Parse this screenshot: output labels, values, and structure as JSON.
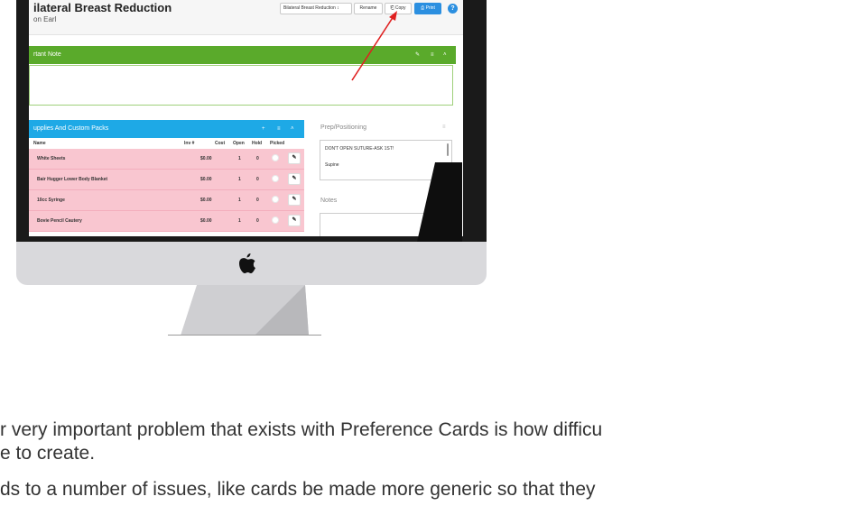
{
  "procedure": {
    "title": "ilateral Breast Reduction",
    "surgeon": "on Earl"
  },
  "toolbar": {
    "card_select": "Bilateral Breast Reduction ↕",
    "rename_label": "Rename",
    "copy_label": "Copy",
    "print_label": "Print",
    "help_label": "?"
  },
  "important_note": {
    "title": "rtant Note",
    "icons": [
      "pencil-icon",
      "menu-icon",
      "chevron-up-icon"
    ],
    "icon_glyphs": [
      "✎",
      "≡",
      "˄"
    ]
  },
  "supplies": {
    "title": "upplies And Custom Packs",
    "icons": [
      "plus-icon",
      "menu-icon",
      "chevron-up-icon"
    ],
    "icon_glyphs": [
      "+",
      "≡",
      "˄"
    ],
    "columns": [
      "Name",
      "Inv #",
      "Cost",
      "Open",
      "Hold",
      "Picked"
    ],
    "rows": [
      {
        "name": "White Sheets",
        "cost": "$0.00",
        "open": "1",
        "hold": "0"
      },
      {
        "name": "Bair Hugger Lower Body Blanket",
        "cost": "$0.00",
        "open": "1",
        "hold": "0"
      },
      {
        "name": "10cc Syringe",
        "cost": "$0.00",
        "open": "1",
        "hold": "0"
      },
      {
        "name": "Bovie Pencil Cautery",
        "cost": "$0.00",
        "open": "1",
        "hold": "0"
      }
    ],
    "edit_glyph": "✎"
  },
  "prep": {
    "label": "Prep/Positioning",
    "icon_glyph": "≡",
    "lines": [
      "DON'T OPEN SUTURE-ASK 1ST!",
      "Supine"
    ]
  },
  "notes": {
    "label": "Notes",
    "icon_glyph": "≡"
  },
  "colors": {
    "green_header": "#5aaa2b",
    "blue_header": "#1ea9e6",
    "pink_row": "#f9c6d0",
    "print_blue": "#2b8fe0",
    "arrow_red": "#e02020"
  },
  "paragraph": {
    "line1": "r very important problem that exists with Preference Cards is how difficu",
    "line2": "e to create.",
    "line3": "ds to a number of issues, like cards be made more generic so that they"
  }
}
